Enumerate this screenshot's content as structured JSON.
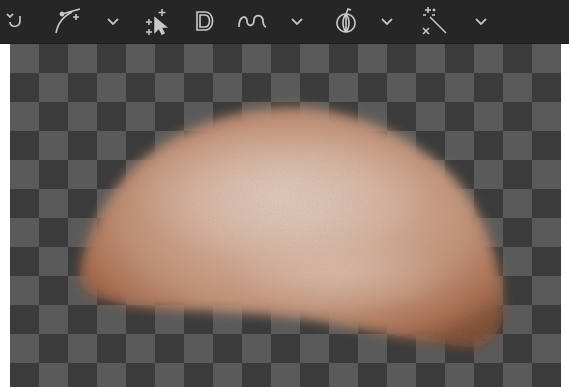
{
  "toolbar": {
    "tools": [
      {
        "icon": "rotate-handle-icon"
      },
      {
        "icon": "bezier-pen-icon"
      },
      {
        "icon": "chevron-down-icon"
      },
      {
        "icon": "select-points-icon"
      },
      {
        "icon": "d-shape-icon"
      },
      {
        "icon": "freehand-curve-icon"
      },
      {
        "icon": "chevron-down-icon"
      },
      {
        "icon": "onion-skin-icon"
      },
      {
        "icon": "chevron-down-icon"
      },
      {
        "icon": "magic-wand-icon"
      },
      {
        "icon": "chevron-down-icon"
      }
    ]
  },
  "viewer": {
    "background": "transparency-checkerboard",
    "subject": "skin-texture-mask",
    "colors": {
      "toolbar": "#262626",
      "icon": "#c9c9c9",
      "checker_light": "#5a5a5a",
      "checker_dark": "#3b3b3b",
      "skin_highlight": "#d8b6a0",
      "skin_mid": "#b98468",
      "skin_edge": "#7a4a2e"
    }
  }
}
